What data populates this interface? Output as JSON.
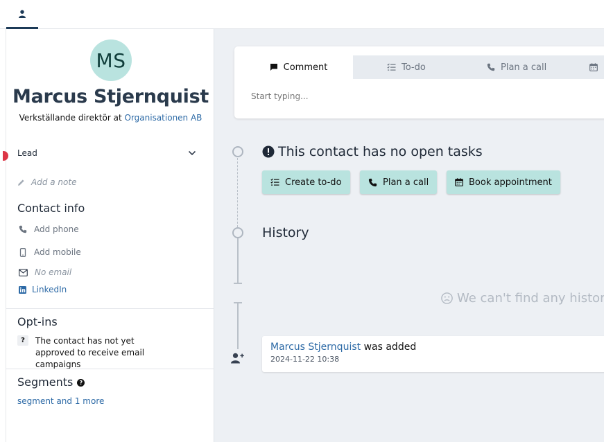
{
  "topbar": {
    "tab_icon": "person-icon"
  },
  "contact": {
    "initials": "MS",
    "name": "Marcus Stjernquist",
    "title_prefix": "Verkställande direktör at",
    "company": "Organisationen AB",
    "status": "Lead",
    "note_placeholder": "Add a note"
  },
  "contact_info": {
    "title": "Contact info",
    "phone": "Add phone",
    "mobile": "Add mobile",
    "email": "No email",
    "linkedin": "LinkedIn"
  },
  "optins": {
    "title": "Opt-ins",
    "badge": "?",
    "text": "The contact has not yet approved to receive email campaigns"
  },
  "segments": {
    "title": "Segments",
    "help": "?",
    "link": "segment and 1 more"
  },
  "composer": {
    "tabs": [
      {
        "label": "Comment",
        "icon": "comment-icon"
      },
      {
        "label": "To-do",
        "icon": "checklist-icon"
      },
      {
        "label": "Plan a call",
        "icon": "phone-icon"
      },
      {
        "label": "",
        "icon": "calendar-icon"
      }
    ],
    "placeholder": "Start typing..."
  },
  "tasks": {
    "no_tasks_text": "This contact has no open tasks",
    "buttons": {
      "create_todo": "Create to-do",
      "plan_call": "Plan a call",
      "book_appointment": "Book appointment"
    }
  },
  "history": {
    "title": "History",
    "empty_text": "We can't find any histor",
    "event": {
      "person": "Marcus Stjernquist",
      "action": "was added",
      "timestamp": "2024-11-22 10:38"
    }
  },
  "colors": {
    "accent": "#b9e3df",
    "link": "#2d6aa6",
    "main_bg": "#edf0f4",
    "active_tab_underline": "#1c3a57"
  }
}
